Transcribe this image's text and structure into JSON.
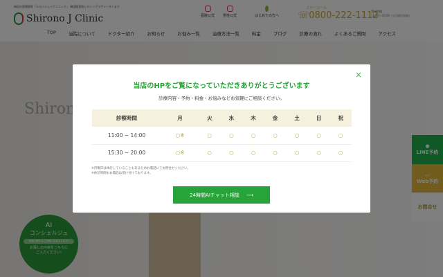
{
  "header": {
    "tagline": "梅田の医療脱毛「シロノジェイクリニック」 梅田駅直結ヒルトンプラザイーストまで",
    "logo": "Shirono J Clinic",
    "icons": [
      {
        "label": "医院公式",
        "icon": "instagram-icon"
      },
      {
        "label": "男性公式",
        "icon": "instagram-icon"
      },
      {
        "label": "はじめての方へ",
        "icon": "leaf-icon"
      }
    ],
    "phone_label": "フリーコール",
    "phone": "0800-222-1112",
    "hours_label": "受付時間",
    "hours": "11:00〜20:00（土日祝日対応）"
  },
  "nav": [
    "TOP",
    "当院について",
    "ドクター紹介",
    "お知らせ",
    "お悩み一覧",
    "治療方法一覧",
    "料金",
    "ブログ",
    "診療の流れ",
    "よくあるご質問",
    "アクセス"
  ],
  "hero": {
    "logo": "Shirono"
  },
  "ai": {
    "title": "AI",
    "subtitle": "コンシェルジュ",
    "pill": "診療に関するご質問にお答えします!",
    "desc1": "お探しの内容をこちらに",
    "desc2": "ご入力ください!"
  },
  "side": {
    "line": "LINE予約",
    "web": "Web予約",
    "contact": "お問合せ"
  },
  "modal": {
    "title": "当店のHPをご覧になっていただきありがとうございます",
    "subtitle": "診療内容・予約・料金・お悩みなどお気軽にご相談ください。",
    "table": {
      "headers": [
        "診察時間",
        "月",
        "火",
        "水",
        "木",
        "金",
        "土",
        "日",
        "祝"
      ],
      "rows": [
        [
          "11:00 ~ 14:00",
          "○※",
          "○",
          "○",
          "○",
          "○",
          "○",
          "○",
          "○"
        ],
        [
          "15:30 ~ 20:00",
          "○※",
          "○",
          "○",
          "○",
          "○",
          "○",
          "○",
          "○"
        ]
      ]
    },
    "notes": [
      "※月曜日は休診していることもあるためお電話にてお問合せください。",
      "※休診時間もお電話は受け付けております。"
    ],
    "cta": "24時間AIチャット相談",
    "cta_arrow": "⟶",
    "close": "×"
  },
  "colors": {
    "accent": "#27a33a",
    "line": "#21b14a",
    "web": "#e2b83a",
    "mark": "#b3a53a"
  }
}
